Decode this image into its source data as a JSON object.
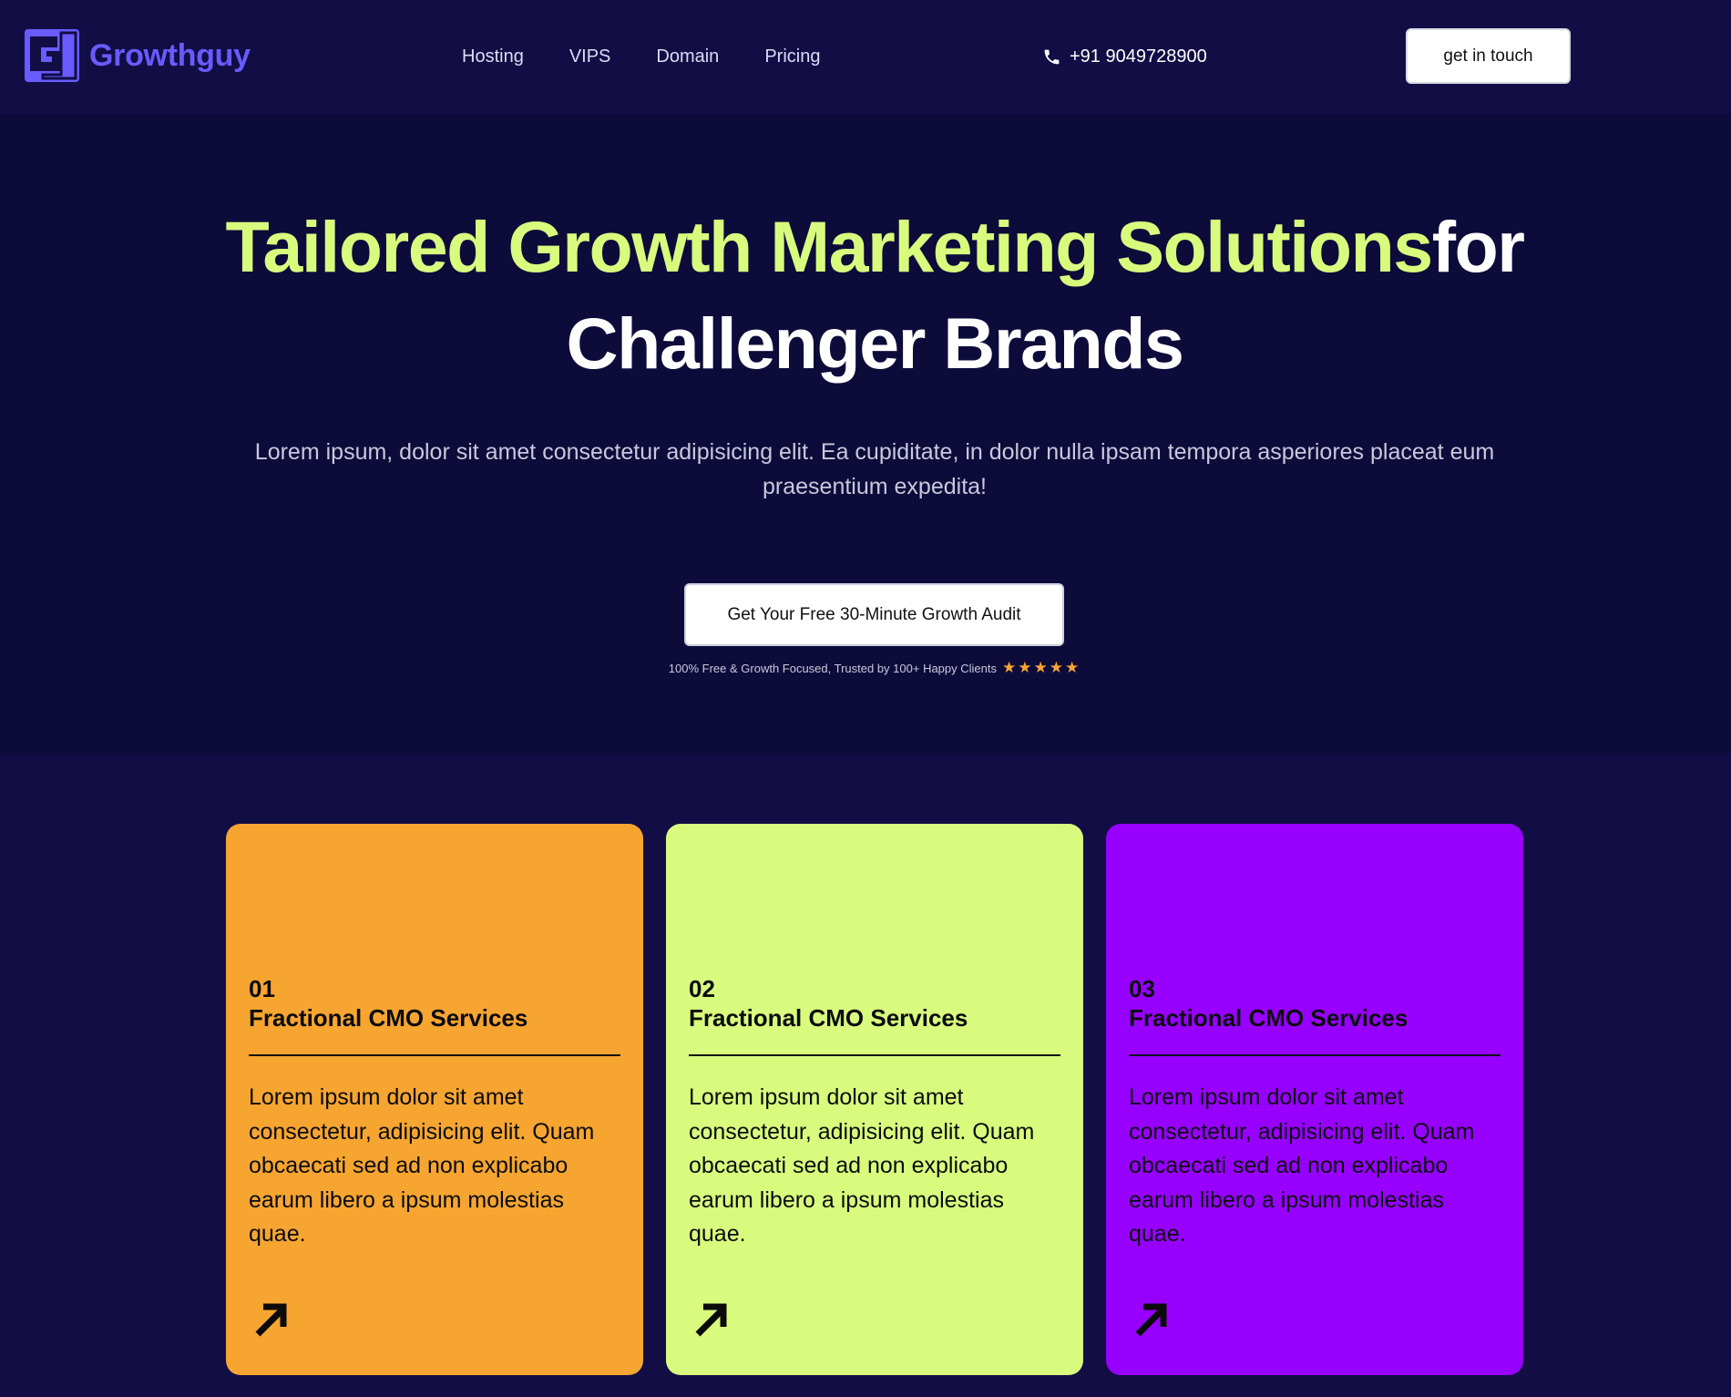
{
  "brand": {
    "name": "Growthguy",
    "logo_icon": "g-logo-icon",
    "color": "#6a5bff"
  },
  "nav": {
    "items": [
      {
        "label": "Hosting"
      },
      {
        "label": "VIPS"
      },
      {
        "label": "Domain"
      },
      {
        "label": "Pricing"
      }
    ]
  },
  "contact": {
    "phone": "+91 9049728900",
    "icon": "phone-icon"
  },
  "header_cta": {
    "label": "get in touch"
  },
  "hero": {
    "title_highlight": "Tailored Growth Marketing Solutions",
    "title_rest": "for Challenger Brands",
    "subtitle": "Lorem ipsum, dolor sit amet consectetur adipisicing elit. Ea cupiditate, in dolor nulla ipsam tempora asperiores placeat eum praesentium expedita!",
    "cta_label": "Get Your Free 30-Minute Growth Audit",
    "trust_text": "100% Free & Growth Focused, Trusted by 100+ Happy Clients",
    "stars": "★★★★★",
    "rating": 5
  },
  "cards": [
    {
      "number": "01",
      "title": "Fractional CMO Services",
      "text": "Lorem ipsum dolor sit amet consectetur, adipisicing elit. Quam obcaecati sed ad non explicabo earum libero a ipsum molestias quae.",
      "color": "#f6a531",
      "icon": "arrow-up-right-icon"
    },
    {
      "number": "02",
      "title": "Fractional CMO Services",
      "text": "Lorem ipsum dolor sit amet consectetur, adipisicing elit. Quam obcaecati sed ad non explicabo earum libero a ipsum molestias quae.",
      "color": "#d8fb7e",
      "icon": "arrow-up-right-icon"
    },
    {
      "number": "03",
      "title": "Fractional CMO Services",
      "text": "Lorem ipsum dolor sit amet consectetur, adipisicing elit. Quam obcaecati sed ad non explicabo earum libero a ipsum molestias quae.",
      "color": "#9700ff",
      "icon": "arrow-up-right-icon"
    }
  ],
  "colors": {
    "background": "#0d0b3a",
    "header_bg": "#120d45",
    "accent_green": "#d8fb7e",
    "star": "#f6a531"
  }
}
